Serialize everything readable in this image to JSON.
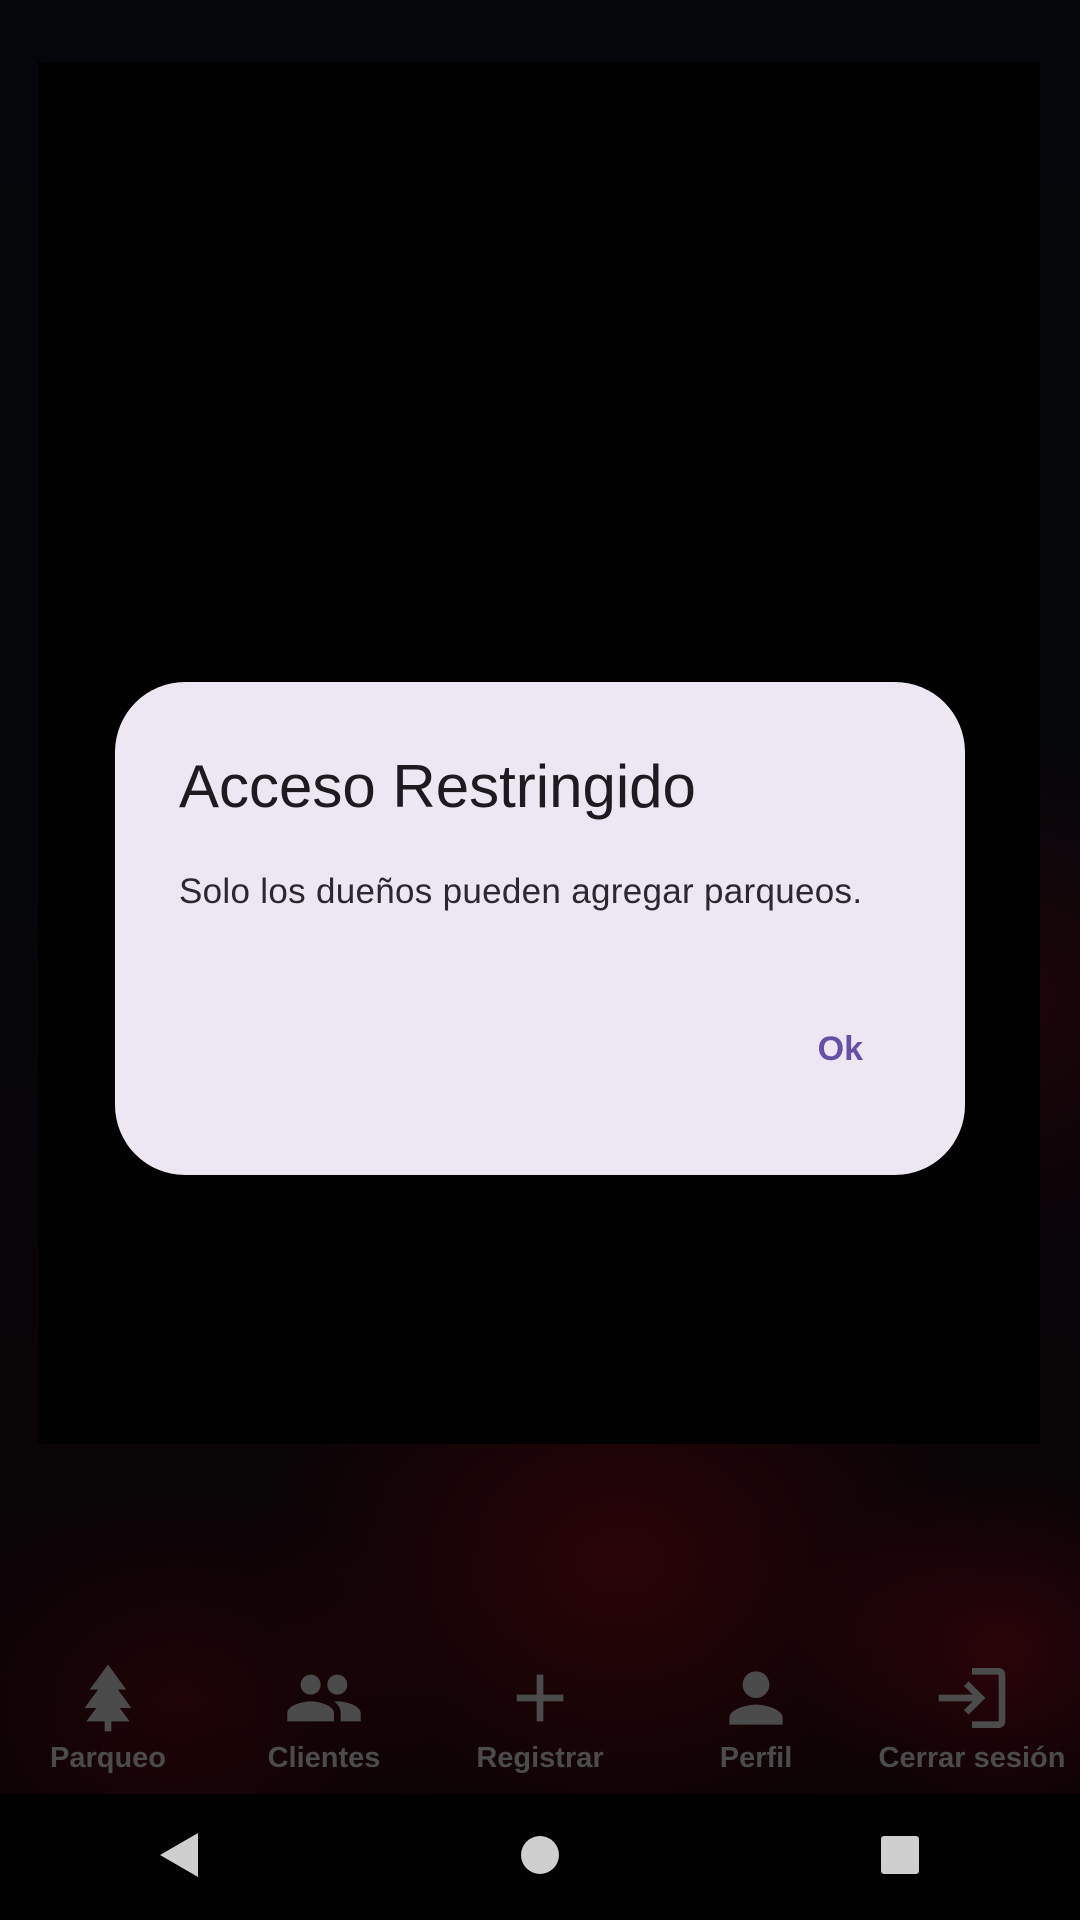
{
  "dialog": {
    "title": "Acceso Restringido",
    "message": "Solo los dueños pueden agregar parqueos.",
    "ok_label": "Ok"
  },
  "bottom_nav": {
    "items": [
      {
        "label": "Parqueo",
        "icon": "tree-icon"
      },
      {
        "label": "Clientes",
        "icon": "people-icon"
      },
      {
        "label": "Registrar",
        "icon": "plus-icon"
      },
      {
        "label": "Perfil",
        "icon": "person-icon"
      },
      {
        "label": "Cerrar sesión",
        "icon": "logout-icon"
      }
    ]
  },
  "system_nav": {
    "back": "back-icon",
    "home": "home-icon",
    "recents": "recents-icon"
  },
  "colors": {
    "dialog_bg": "#ede7f4",
    "accent": "#6750a4",
    "nav_label": "#7a7a7a"
  }
}
